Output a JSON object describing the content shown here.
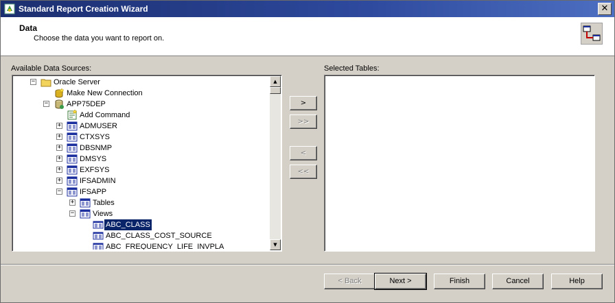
{
  "window": {
    "title": "Standard Report Creation Wizard",
    "close_glyph": "✕"
  },
  "header": {
    "title": "Data",
    "subtitle": "Choose the data you want to report on."
  },
  "available": {
    "label": "Available Data Sources:",
    "tree": [
      {
        "label": "Oracle Server",
        "icon": "folder-icon",
        "expander": "−"
      },
      {
        "label": "Make New Connection",
        "icon": "new-connection-icon",
        "expander": ""
      },
      {
        "label": "APP75DEP",
        "icon": "database-icon",
        "expander": "−"
      },
      {
        "label": "Add Command",
        "icon": "add-command-icon",
        "expander": ""
      },
      {
        "label": "ADMUSER",
        "icon": "schema-icon",
        "expander": "+"
      },
      {
        "label": "CTXSYS",
        "icon": "schema-icon",
        "expander": "+"
      },
      {
        "label": "DBSNMP",
        "icon": "schema-icon",
        "expander": "+"
      },
      {
        "label": "DMSYS",
        "icon": "schema-icon",
        "expander": "+"
      },
      {
        "label": "EXFSYS",
        "icon": "schema-icon",
        "expander": "+"
      },
      {
        "label": "IFSADMIN",
        "icon": "schema-icon",
        "expander": "+"
      },
      {
        "label": "IFSAPP",
        "icon": "schema-icon",
        "expander": "−"
      },
      {
        "label": "Tables",
        "icon": "schema-icon",
        "expander": "+"
      },
      {
        "label": "Views",
        "icon": "schema-icon",
        "expander": "−"
      },
      {
        "label": "ABC_CLASS",
        "icon": "view-icon",
        "expander": ""
      },
      {
        "label": "ABC_CLASS_COST_SOURCE",
        "icon": "view-icon",
        "expander": ""
      },
      {
        "label": "ABC_FREQUENCY_LIFE_INVPLA",
        "icon": "view-icon",
        "expander": ""
      }
    ],
    "selected_item": "ABC_CLASS"
  },
  "selected_tables": {
    "label": "Selected Tables:"
  },
  "transfer_buttons": {
    "add": ">",
    "add_all": ">>",
    "remove": "<",
    "remove_all": "<<"
  },
  "footer": {
    "back": "< Back",
    "next": "Next >",
    "finish": "Finish",
    "cancel": "Cancel",
    "help": "Help"
  },
  "colors": {
    "selection": "#0a246a",
    "titlebar": "#1b2e6f",
    "face": "#d4d0c8"
  }
}
